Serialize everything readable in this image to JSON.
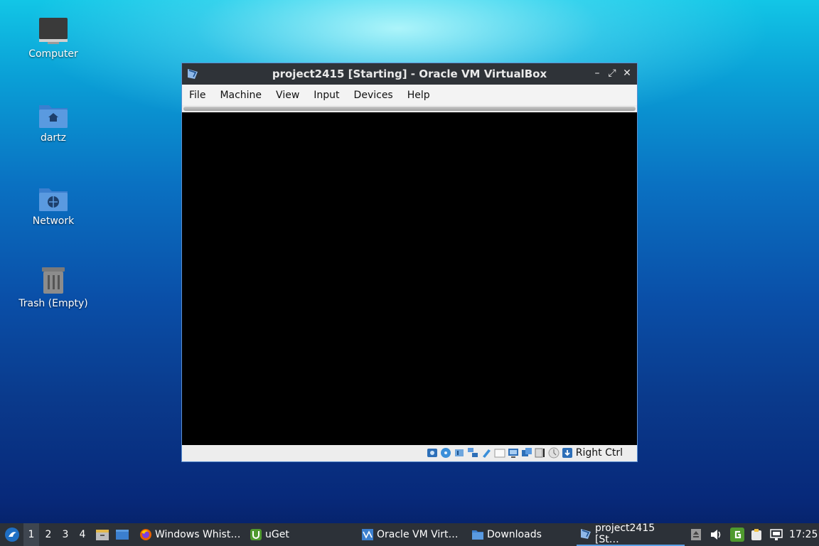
{
  "desktop": {
    "icons": [
      {
        "label": "Computer",
        "icon": "computer-icon"
      },
      {
        "label": "dartz",
        "icon": "home-folder-icon"
      },
      {
        "label": "Network",
        "icon": "network-folder-icon"
      },
      {
        "label": "Trash (Empty)",
        "icon": "trash-icon"
      }
    ]
  },
  "window": {
    "title": "project2415 [Starting] - Oracle VM VirtualBox",
    "menu": [
      "File",
      "Machine",
      "View",
      "Input",
      "Devices",
      "Help"
    ],
    "controls": [
      "minimize-icon",
      "maximize-icon",
      "close-icon"
    ],
    "status_icons": [
      "hard-disk-icon",
      "optical-disk-icon",
      "audio-icon",
      "network-icon",
      "usb-icon",
      "shared-folders-icon",
      "display-icon",
      "video-capture-icon",
      "vt-x-icon",
      "mouse-integration-icon",
      "keyboard-icon"
    ],
    "host_key": "Right Ctrl"
  },
  "taskbar": {
    "workspaces": [
      "1",
      "2",
      "3",
      "4"
    ],
    "active_workspace": "1",
    "tasks": [
      {
        "label": "Windows Whist…",
        "icon": "firefox-icon"
      },
      {
        "label": "uGet",
        "icon": "uget-icon"
      },
      {
        "label": "Oracle VM Virt…",
        "icon": "virtualbox-icon"
      },
      {
        "label": "Downloads",
        "icon": "folder-icon"
      },
      {
        "label": "project2415 [St…",
        "icon": "virtualbox-vm-icon"
      }
    ],
    "clock": "17:25"
  }
}
